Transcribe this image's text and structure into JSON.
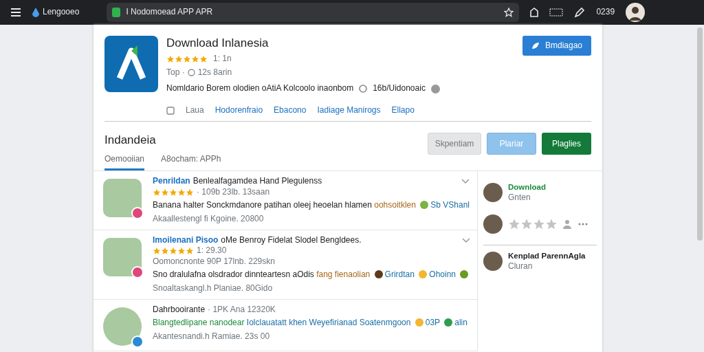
{
  "topbar": {
    "brand": "Lengooeo",
    "address": "I Nodomoead APP APR",
    "time": "0239"
  },
  "app": {
    "title": "Download Inlanesia",
    "stars": 5,
    "rating": "1: 1n",
    "meta_label": "Top ·",
    "meta_value": "12s 8arin",
    "description": "Nomldario Borem olodien oAtiA Kolcoolo inaonbom",
    "description_extra": "16b/Uidonoaic",
    "links": [
      {
        "label": "Laua",
        "kind": "muted"
      },
      {
        "label": "Hodorenfraio",
        "kind": "link"
      },
      {
        "label": "Ebacono",
        "kind": "link"
      },
      {
        "label": "Iadiage Manirogs",
        "kind": "link"
      },
      {
        "label": "Ellapo",
        "kind": "link"
      }
    ],
    "install_button": "Bmdiagao"
  },
  "section": {
    "title": "Indandeia",
    "tabs": [
      {
        "label": "Oemooiian",
        "selected": true
      },
      {
        "label": "A8ocham: APPh",
        "selected": false
      }
    ],
    "buttons": [
      {
        "label": "Skpentiam",
        "kind": "secondary"
      },
      {
        "label": "Plariar",
        "kind": "info"
      },
      {
        "label": "Plaglies",
        "kind": "success"
      }
    ]
  },
  "reviews": [
    {
      "author": "Penrildan",
      "title": "Benlealfagamdea Hand Plegulenss",
      "stars": 5,
      "meta": "· 109b 23lb. 13saan",
      "expanded": false,
      "badge": {
        "color": "#e0457b"
      },
      "body": [
        {
          "kind": "text",
          "color": "#222222",
          "text": "Banana halter Sonckmdanore patihan oleej heoelan hlamen"
        },
        {
          "kind": "text",
          "color": "#a8641a",
          "text": "oohsoitklen"
        },
        {
          "kind": "emoji",
          "color": "#7cb342"
        },
        {
          "kind": "text",
          "color": "#1a6fa5",
          "text": "Sb  VShanl"
        }
      ],
      "date": "Akaallestengl fi Kgoine. 20800"
    },
    {
      "author": "Imoilenani Pisoo",
      "title": "oMe Benroy Fidelat Slodel Bengldees.",
      "stars": 5,
      "meta": "1: 29.30",
      "meta_2": "Oomoncnonte 90P 17lnb. 229skn",
      "expanded": false,
      "badge": {
        "color": "#e0457b"
      },
      "body": [
        {
          "kind": "text",
          "color": "#222222",
          "text": "Sno dralulafna olsdrador dinnteartesn aOdis"
        },
        {
          "kind": "text",
          "color": "#a8641a",
          "text": "fang fienaolian"
        },
        {
          "kind": "emoji",
          "color": "#5d3a1a"
        },
        {
          "kind": "text",
          "color": "#1a6fa5",
          "text": "Grirdtan"
        },
        {
          "kind": "emoji",
          "color": "#f2b632"
        },
        {
          "kind": "text",
          "color": "#1a6fa5",
          "text": "Ohoinn"
        },
        {
          "kind": "emoji",
          "color": "#6a9a1f"
        }
      ],
      "date": "Snoaltaskangl.h Planiae. 80Gido"
    },
    {
      "author": "Dahrbooirante",
      "meta": "· 1PK Ana 12320K",
      "badge": {
        "color": "#2a8ad4"
      },
      "body": [
        {
          "kind": "text",
          "color": "#1b8a3a",
          "text": "Blangtedlipane nanodear"
        },
        {
          "kind": "text",
          "color": "#1a6fa5",
          "text": "Iolclauatatt khen Weyefirianad Soatenmgoon"
        },
        {
          "kind": "emoji",
          "color": "#f2b632"
        },
        {
          "kind": "text",
          "color": "#1a6fa5",
          "text": "03P"
        },
        {
          "kind": "emoji",
          "color": "#2e9e4a"
        },
        {
          "kind": "text",
          "color": "#1a6fa5",
          "text": "alin"
        }
      ],
      "date": "Akantesnandi.h Ramiae. 23s 00"
    }
  ],
  "sidebar": [
    {
      "kind": "person",
      "name": "Download",
      "sub": "Gnten",
      "color": "#1b8a3a"
    },
    {
      "kind": "rating",
      "stars": 0
    },
    {
      "kind": "person",
      "name": "Kenplad ParennAgla",
      "sub": "Cluran",
      "color": "#222222"
    }
  ]
}
